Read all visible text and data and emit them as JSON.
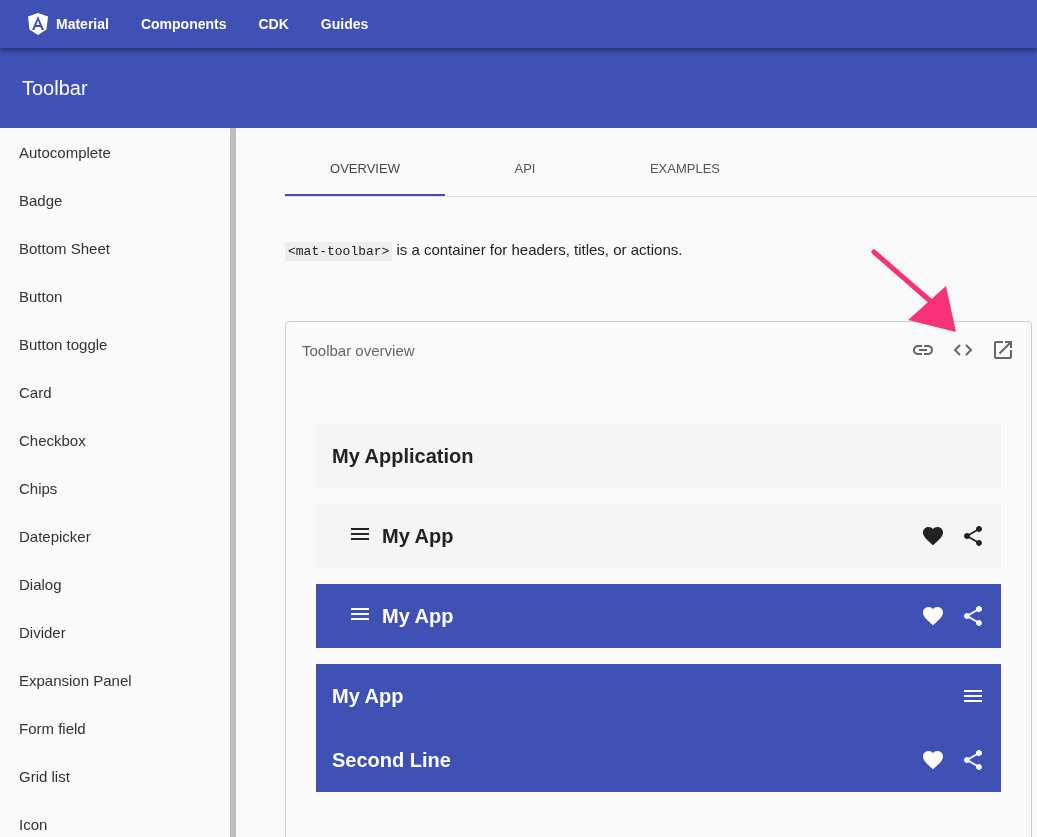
{
  "top_nav": {
    "logo_text": "Material",
    "links": [
      "Components",
      "CDK",
      "Guides"
    ]
  },
  "header": {
    "title": "Toolbar"
  },
  "sidebar": {
    "items": [
      {
        "label": "Autocomplete"
      },
      {
        "label": "Badge"
      },
      {
        "label": "Bottom Sheet"
      },
      {
        "label": "Button"
      },
      {
        "label": "Button toggle"
      },
      {
        "label": "Card"
      },
      {
        "label": "Checkbox"
      },
      {
        "label": "Chips"
      },
      {
        "label": "Datepicker"
      },
      {
        "label": "Dialog"
      },
      {
        "label": "Divider"
      },
      {
        "label": "Expansion Panel"
      },
      {
        "label": "Form field"
      },
      {
        "label": "Grid list"
      },
      {
        "label": "Icon"
      }
    ]
  },
  "tabs": [
    {
      "label": "OVERVIEW",
      "selected": true
    },
    {
      "label": "API",
      "selected": false
    },
    {
      "label": "EXAMPLES",
      "selected": false
    }
  ],
  "description": {
    "code": "<mat-toolbar>",
    "text": "is a container for headers, titles, or actions."
  },
  "example": {
    "title": "Toolbar overview",
    "toolbars": [
      {
        "kind": "default",
        "rows": [
          {
            "title": "My Application",
            "leading_menu": false,
            "trailing_menu": false,
            "actions": false
          }
        ]
      },
      {
        "kind": "default",
        "rows": [
          {
            "title": "My App",
            "leading_menu": true,
            "trailing_menu": false,
            "actions": true
          }
        ]
      },
      {
        "kind": "primary",
        "rows": [
          {
            "title": "My App",
            "leading_menu": true,
            "trailing_menu": false,
            "actions": true
          }
        ]
      },
      {
        "kind": "primary",
        "rows": [
          {
            "title": "My App",
            "leading_menu": false,
            "trailing_menu": true,
            "actions": false
          },
          {
            "title": "Second Line",
            "leading_menu": false,
            "trailing_menu": false,
            "actions": true
          }
        ]
      }
    ]
  }
}
